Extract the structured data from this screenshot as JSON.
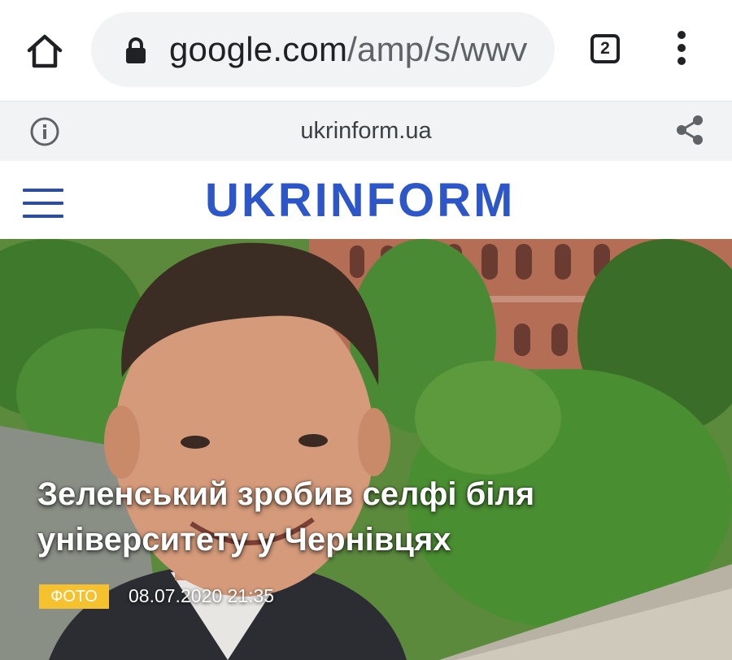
{
  "browser": {
    "url_host": "google.com",
    "url_path": "/amp/s/wwv",
    "tab_count": "2"
  },
  "amp": {
    "domain": "ukrinform.ua"
  },
  "site": {
    "logo": "UKRINFORM"
  },
  "article": {
    "title_line1": "Зеленський зробив селфі біля",
    "title_line2": "університету у Чернівцях",
    "badge": "ФОТО",
    "date": "08.07.2020 21:35"
  },
  "colors": {
    "brand_blue": "#2d56c8",
    "badge_yellow": "#f5c12e"
  },
  "icons": [
    "home-icon",
    "lock-icon",
    "tabs-icon",
    "more-vert-icon",
    "info-icon",
    "share-icon",
    "menu-icon"
  ]
}
